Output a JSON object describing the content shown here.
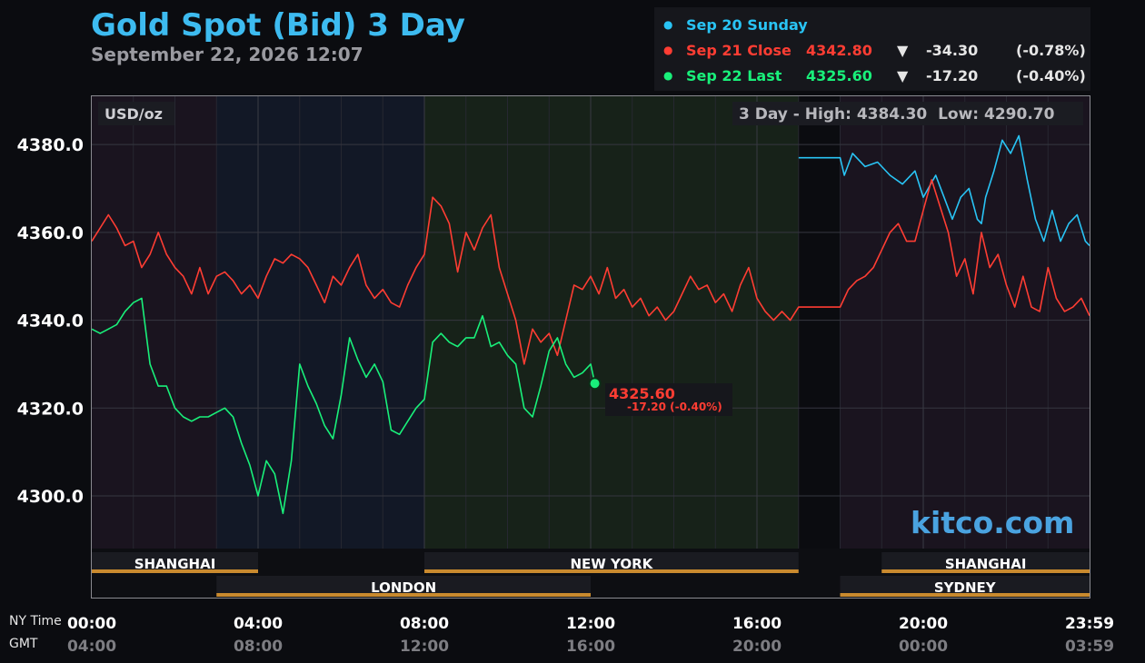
{
  "title": "Gold Spot (Bid) 3 Day",
  "subtitle": "September 22, 2026 12:07",
  "legend": [
    {
      "label": "Sep 20 Sunday",
      "price": "",
      "arrow": "",
      "change": "",
      "pct": "",
      "color": "#29c4f5"
    },
    {
      "label": "Sep 21 Close",
      "price": "4342.80",
      "arrow": "▼",
      "change": "-34.30",
      "pct": "(-0.78%)",
      "color": "#ff3d33"
    },
    {
      "label": "Sep 22 Last",
      "price": "4325.60",
      "arrow": "▼",
      "change": "-17.20",
      "pct": "(-0.40%)",
      "color": "#19f07a"
    }
  ],
  "unit_label": "USD/oz",
  "high_low": "3 Day - High: 4384.30  Low: 4290.70",
  "last_price_label": "4325.60",
  "last_change_label": "-17.20 (-0.40%)",
  "watermark": "kitco.com",
  "axis_labels": {
    "ny_time": "NY Time",
    "gmt": "GMT"
  },
  "markets": {
    "shanghai": "SHANGHAI",
    "london": "LONDON",
    "new_york": "NEW YORK",
    "sydney": "SYDNEY"
  },
  "chart_data": {
    "type": "line",
    "title": "Gold Spot (Bid) 3 Day",
    "ylabel": "USD/oz",
    "ylim": [
      4288,
      4391
    ],
    "xlim": [
      0,
      24
    ],
    "y_ticks": [
      4300.0,
      4320.0,
      4340.0,
      4360.0,
      4380.0
    ],
    "y_tick_labels": [
      "4300.0",
      "4320.0",
      "4340.0",
      "4360.0",
      "4380.0"
    ],
    "x_ticks": [
      0,
      4,
      8,
      12,
      16,
      20,
      24
    ],
    "x_tick_labels_ny": [
      "00:00",
      "04:00",
      "08:00",
      "12:00",
      "16:00",
      "20:00",
      "23:59"
    ],
    "x_tick_labels_gmt": [
      "04:00",
      "08:00",
      "12:00",
      "16:00",
      "20:00",
      "00:00",
      "03:59"
    ],
    "grid": true,
    "series": [
      {
        "name": "Sep 20 Sunday",
        "color": "#29c4f5",
        "x": [
          17.0,
          18.0,
          18.1,
          18.3,
          18.6,
          18.9,
          19.2,
          19.5,
          19.8,
          20.0,
          20.3,
          20.5,
          20.7,
          20.9,
          21.1,
          21.3,
          21.4,
          21.5,
          21.7,
          21.9,
          22.1,
          22.3,
          22.5,
          22.7,
          22.9,
          23.1,
          23.3,
          23.5,
          23.7,
          23.9,
          24.0
        ],
        "y": [
          4377.0,
          4377.0,
          4373.0,
          4378.0,
          4375.0,
          4376.0,
          4373.0,
          4371.0,
          4374.0,
          4368.0,
          4373.0,
          4368.0,
          4363.0,
          4368.0,
          4370.0,
          4363.0,
          4362.0,
          4368.0,
          4374.0,
          4381.0,
          4378.0,
          4382.0,
          4372.0,
          4363.0,
          4358.0,
          4365.0,
          4358.0,
          4362.0,
          4364.0,
          4358.0,
          4357.0
        ]
      },
      {
        "name": "Sep 21 Close",
        "color": "#ff3d33",
        "x": [
          0.0,
          0.2,
          0.4,
          0.6,
          0.8,
          1.0,
          1.2,
          1.4,
          1.6,
          1.8,
          2.0,
          2.2,
          2.4,
          2.6,
          2.8,
          3.0,
          3.2,
          3.4,
          3.6,
          3.8,
          4.0,
          4.2,
          4.4,
          4.6,
          4.8,
          5.0,
          5.2,
          5.4,
          5.6,
          5.8,
          6.0,
          6.2,
          6.4,
          6.6,
          6.8,
          7.0,
          7.2,
          7.4,
          7.6,
          7.8,
          8.0,
          8.2,
          8.4,
          8.6,
          8.8,
          9.0,
          9.2,
          9.4,
          9.6,
          9.8,
          10.0,
          10.2,
          10.4,
          10.6,
          10.8,
          11.0,
          11.2,
          11.4,
          11.6,
          11.8,
          12.0,
          12.2,
          12.4,
          12.6,
          12.8,
          13.0,
          13.2,
          13.4,
          13.6,
          13.8,
          14.0,
          14.2,
          14.4,
          14.6,
          14.8,
          15.0,
          15.2,
          15.4,
          15.6,
          15.8,
          16.0,
          16.2,
          16.4,
          16.6,
          16.8,
          17.0,
          18.0,
          18.2,
          18.4,
          18.6,
          18.8,
          19.0,
          19.2,
          19.4,
          19.6,
          19.8,
          20.0,
          20.2,
          20.4,
          20.6,
          20.8,
          21.0,
          21.2,
          21.4,
          21.6,
          21.8,
          22.0,
          22.2,
          22.4,
          22.6,
          22.8,
          23.0,
          23.2,
          23.4,
          23.6,
          23.8,
          24.0
        ],
        "y": [
          4358.0,
          4361.0,
          4364.0,
          4361.0,
          4357.0,
          4358.0,
          4352.0,
          4355.0,
          4360.0,
          4355.0,
          4352.0,
          4350.0,
          4346.0,
          4352.0,
          4346.0,
          4350.0,
          4351.0,
          4349.0,
          4346.0,
          4348.0,
          4345.0,
          4350.0,
          4354.0,
          4353.0,
          4355.0,
          4354.0,
          4352.0,
          4348.0,
          4344.0,
          4350.0,
          4348.0,
          4352.0,
          4355.0,
          4348.0,
          4345.0,
          4347.0,
          4344.0,
          4343.0,
          4348.0,
          4352.0,
          4355.0,
          4368.0,
          4366.0,
          4362.0,
          4351.0,
          4360.0,
          4356.0,
          4361.0,
          4364.0,
          4352.0,
          4346.0,
          4340.0,
          4330.0,
          4338.0,
          4335.0,
          4337.0,
          4332.0,
          4340.0,
          4348.0,
          4347.0,
          4350.0,
          4346.0,
          4352.0,
          4345.0,
          4347.0,
          4343.0,
          4345.0,
          4341.0,
          4343.0,
          4340.0,
          4342.0,
          4346.0,
          4350.0,
          4347.0,
          4348.0,
          4344.0,
          4346.0,
          4342.0,
          4348.0,
          4352.0,
          4345.0,
          4342.0,
          4340.0,
          4342.0,
          4340.0,
          4343.0,
          4343.0,
          4347.0,
          4349.0,
          4350.0,
          4352.0,
          4356.0,
          4360.0,
          4362.0,
          4358.0,
          4358.0,
          4365.0,
          4372.0,
          4366.0,
          4360.0,
          4350.0,
          4354.0,
          4346.0,
          4360.0,
          4352.0,
          4355.0,
          4348.0,
          4343.0,
          4350.0,
          4343.0,
          4342.0,
          4352.0,
          4345.0,
          4342.0,
          4343.0,
          4345.0,
          4341.0
        ]
      },
      {
        "name": "Sep 22 Last",
        "color": "#19f07a",
        "x": [
          0.0,
          0.2,
          0.4,
          0.6,
          0.8,
          1.0,
          1.2,
          1.4,
          1.6,
          1.8,
          2.0,
          2.2,
          2.4,
          2.6,
          2.8,
          3.0,
          3.2,
          3.4,
          3.6,
          3.8,
          4.0,
          4.2,
          4.4,
          4.6,
          4.8,
          5.0,
          5.2,
          5.4,
          5.6,
          5.8,
          6.0,
          6.2,
          6.4,
          6.6,
          6.8,
          7.0,
          7.2,
          7.4,
          7.6,
          7.8,
          8.0,
          8.2,
          8.4,
          8.6,
          8.8,
          9.0,
          9.2,
          9.4,
          9.6,
          9.8,
          10.0,
          10.2,
          10.4,
          10.6,
          10.8,
          11.0,
          11.2,
          11.4,
          11.6,
          11.8,
          12.0,
          12.1
        ],
        "y": [
          4338.0,
          4337.0,
          4338.0,
          4339.0,
          4342.0,
          4344.0,
          4345.0,
          4330.0,
          4325.0,
          4325.0,
          4320.0,
          4318.0,
          4317.0,
          4318.0,
          4318.0,
          4319.0,
          4320.0,
          4318.0,
          4312.0,
          4307.0,
          4300.0,
          4308.0,
          4305.0,
          4296.0,
          4308.0,
          4330.0,
          4325.0,
          4321.0,
          4316.0,
          4313.0,
          4323.0,
          4336.0,
          4331.0,
          4327.0,
          4330.0,
          4326.0,
          4315.0,
          4314.0,
          4317.0,
          4320.0,
          4322.0,
          4335.0,
          4337.0,
          4335.0,
          4334.0,
          4336.0,
          4336.0,
          4341.0,
          4334.0,
          4335.0,
          4332.0,
          4330.0,
          4320.0,
          4318.0,
          4325.0,
          4333.0,
          4336.0,
          4330.0,
          4327.0,
          4328.0,
          4330.0,
          4325.6
        ]
      }
    ]
  }
}
